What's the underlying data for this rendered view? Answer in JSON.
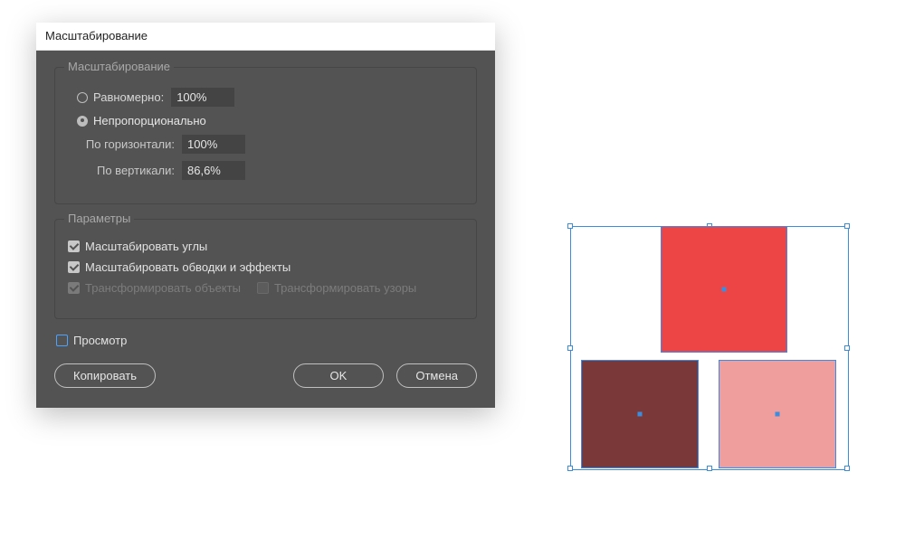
{
  "dialog": {
    "title": "Масштабирование",
    "group_scale_title": "Масштабирование",
    "uniform_label": "Равномерно:",
    "uniform_value": "100%",
    "nonuniform_label": "Непропорционально",
    "horiz_label": "По горизонтали:",
    "horiz_value": "100%",
    "vert_label": "По вертикали:",
    "vert_value": "86,6%",
    "group_opts_title": "Параметры",
    "scale_corners_label": "Масштабировать углы",
    "scale_strokes_label": "Масштабировать обводки и эффекты",
    "transform_objects_label": "Трансформировать объекты",
    "transform_patterns_label": "Трансформировать узоры",
    "preview_label": "Просмотр",
    "copy_btn": "Копировать",
    "ok_btn": "OK",
    "cancel_btn": "Отмена"
  },
  "canvas": {
    "colors": {
      "top": "#ed4545",
      "bottom_left": "#7b3838",
      "bottom_right": "#f09d9d",
      "selection": "#3b8de0"
    }
  }
}
